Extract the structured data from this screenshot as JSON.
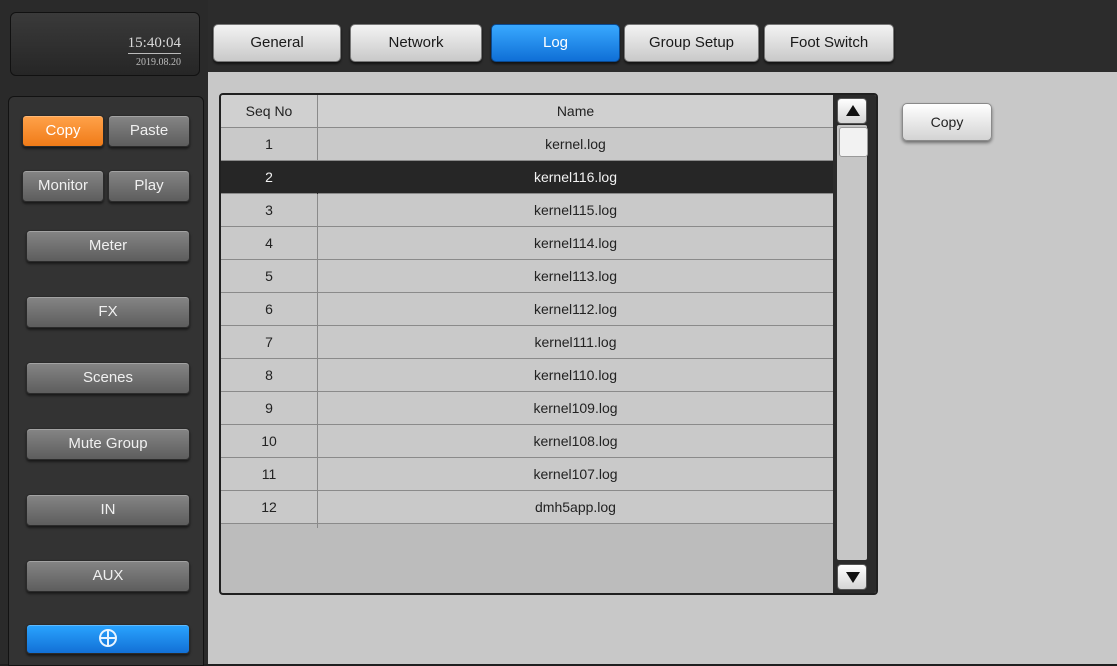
{
  "clock": {
    "time": "15:40:04",
    "date": "2019.08.20"
  },
  "sidebar": {
    "copy_label": "Copy",
    "paste_label": "Paste",
    "monitor_label": "Monitor",
    "play_label": "Play",
    "meter_label": "Meter",
    "fx_label": "FX",
    "scenes_label": "Scenes",
    "mute_group_label": "Mute Group",
    "in_label": "IN",
    "aux_label": "AUX",
    "home_icon": "globe-icon"
  },
  "tabs": [
    {
      "label": "General"
    },
    {
      "label": "Network"
    },
    {
      "label": "Log",
      "active": true
    },
    {
      "label": "Group Setup"
    },
    {
      "label": "Foot Switch"
    }
  ],
  "log_table": {
    "headers": {
      "seq": "Seq No",
      "name": "Name"
    },
    "rows": [
      {
        "seq": "1",
        "name": "kernel.log"
      },
      {
        "seq": "2",
        "name": "kernel116.log",
        "selected": true
      },
      {
        "seq": "3",
        "name": "kernel115.log"
      },
      {
        "seq": "4",
        "name": "kernel114.log"
      },
      {
        "seq": "5",
        "name": "kernel113.log"
      },
      {
        "seq": "6",
        "name": "kernel112.log"
      },
      {
        "seq": "7",
        "name": "kernel111.log"
      },
      {
        "seq": "8",
        "name": "kernel110.log"
      },
      {
        "seq": "9",
        "name": "kernel109.log"
      },
      {
        "seq": "10",
        "name": "kernel108.log"
      },
      {
        "seq": "11",
        "name": "kernel107.log"
      },
      {
        "seq": "12",
        "name": "dmh5app.log"
      }
    ]
  },
  "actions": {
    "copy_label": "Copy"
  },
  "colors": {
    "accent_active": "#1f8ae8",
    "copy_active": "#f58a2a",
    "selected_row": "#262626"
  }
}
